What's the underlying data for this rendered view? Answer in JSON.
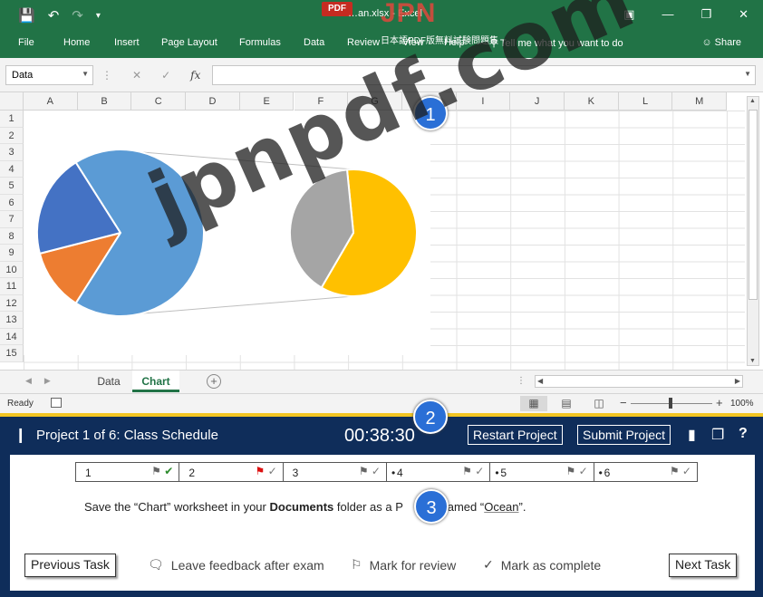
{
  "excel": {
    "title": "…an.xlsx - Excel",
    "pdf_badge": "PDF",
    "brand_text": "JPN",
    "brand_sub": "日本語PDF版無料試験問題集",
    "ribbon_tabs": [
      "File",
      "Home",
      "Insert",
      "Page Layout",
      "Formulas",
      "Data",
      "Review",
      "View",
      "Help"
    ],
    "tell_me": "Tell me what you want to do",
    "share": "Share",
    "name_box": "Data",
    "fx_label": "fx",
    "columns": [
      "A",
      "B",
      "C",
      "D",
      "E",
      "F",
      "G",
      "H",
      "I",
      "J",
      "K",
      "L",
      "M"
    ],
    "rows": [
      "1",
      "2",
      "3",
      "4",
      "5",
      "6",
      "7",
      "8",
      "9",
      "10",
      "11",
      "12",
      "13",
      "14",
      "15"
    ],
    "sheets": [
      {
        "name": "Data",
        "active": false
      },
      {
        "name": "Chart",
        "active": true
      }
    ],
    "status_ready": "Ready",
    "zoom": "100%"
  },
  "chart_data": {
    "type": "pie",
    "subtype": "pie-of-pie",
    "main_slices": [
      {
        "value": 0.12,
        "color": "#ed7d31"
      },
      {
        "value": 0.2,
        "color": "#4472c4"
      },
      {
        "value": 0.68,
        "color": "#5b9bd5"
      }
    ],
    "secondary_slices": [
      {
        "value": 0.6,
        "color": "#ffc000"
      },
      {
        "value": 0.4,
        "color": "#a5a5a5"
      }
    ]
  },
  "exam": {
    "project_title": "Project 1 of 6: Class Schedule",
    "timer": "00:38:30",
    "restart_label": "Restart Project",
    "submit_label": "Submit Project",
    "tasks": [
      {
        "num": "1",
        "bullet": false,
        "flagged": false,
        "complete": true,
        "current": false
      },
      {
        "num": "2",
        "bullet": false,
        "flagged": true,
        "complete": false,
        "current": false
      },
      {
        "num": "3",
        "bullet": false,
        "flagged": false,
        "complete": false,
        "current": true
      },
      {
        "num": "4",
        "bullet": true,
        "flagged": false,
        "complete": false,
        "current": false
      },
      {
        "num": "5",
        "bullet": true,
        "flagged": false,
        "complete": false,
        "current": false
      },
      {
        "num": "6",
        "bullet": true,
        "flagged": false,
        "complete": false,
        "current": false
      }
    ],
    "instruction": {
      "pre": "Save the “Chart” worksheet in your ",
      "bold": "Documents",
      "mid": " folder as a P",
      "post": " named “",
      "name": "Ocean",
      "end": "”."
    },
    "previous_task": "Previous Task",
    "feedback": "Leave feedback after exam",
    "mark_review": "Mark for review",
    "mark_complete": "Mark as complete",
    "next_task": "Next Task"
  },
  "callouts": [
    "1",
    "2",
    "3"
  ],
  "watermark": "jpnpdf.com",
  "colors": {
    "excel_green": "#217346",
    "exam_navy": "#0f2d5a",
    "accent_yellow": "#f2c523",
    "callout_blue": "#2a6fd6"
  }
}
